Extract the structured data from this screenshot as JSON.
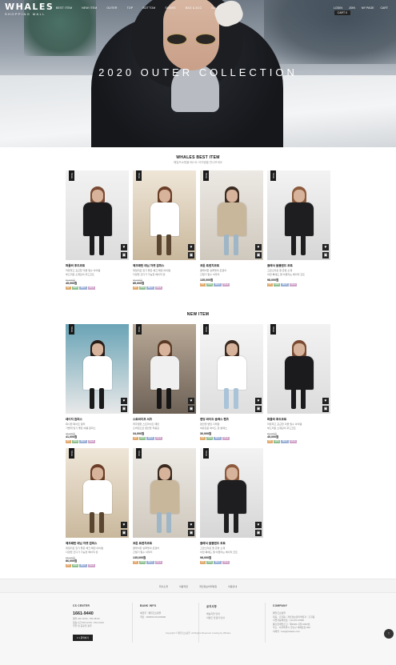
{
  "header": {
    "logo_main": "WHALES",
    "logo_sub": "SHOPPING MALL",
    "gnb": [
      "BEST ITEM",
      "NEW ITEM",
      "OUTER",
      "TOP",
      "BOTTOM",
      "SHOES",
      "BAG & ACC",
      "SALE"
    ],
    "util": [
      "LOGIN",
      "JOIN",
      "MY PAGE",
      "CART"
    ],
    "cart_badge": "CART 0"
  },
  "hero": {
    "title": "2020 OUTER COLLECTION"
  },
  "best": {
    "title": "WHALES BEST ITEM",
    "subtitle": "웨일즈쇼핑몰 베스트 아이템을 만나보세요",
    "products": [
      {
        "name": "퍼플러 후드코트",
        "desc": [
          "따뜻하고 포근한 겨울 필수 아이템",
          "부드러운 소재감의 후드코트"
        ],
        "oprice": "50,000원",
        "price": "45,000원",
        "sale": "SALE"
      },
      {
        "name": "체크패턴 데님 자켓 원피스",
        "desc": [
          "데일리로 입기 좋은 체크 패턴 아이템",
          "다양한 코디가 가능한 베이직 핏"
        ],
        "oprice": "95,000원",
        "price": "85,000원",
        "sale": "SALE"
      },
      {
        "name": "코튼 트렌치코트",
        "desc": [
          "클래식한 실루엣의 트렌치",
          "간절기 필수 아우터"
        ],
        "oprice": "",
        "price": "135,000원",
        "sale": "SALE"
      },
      {
        "name": "클래식 울블렌드 코트",
        "desc": [
          "고급스러운 울 혼방 소재",
          "어떤 룩에도 잘 어울리는 베이직 코트"
        ],
        "oprice": "",
        "price": "98,000원",
        "sale": "SALE"
      }
    ]
  },
  "newitem": {
    "title": "NEW ITEM",
    "products": [
      {
        "name": "데이지 원피스",
        "desc": [
          "화사한 화이트 컬러",
          "가볍게 입기 좋은 여름 원피스"
        ],
        "oprice": "45,000원",
        "price": "41,000원",
        "sale": "SALE"
      },
      {
        "name": "스트라이프 셔츠",
        "desc": [
          "캐주얼한 스트라이프 패턴",
          "오버핏으로 편안한 착용감"
        ],
        "oprice": "",
        "price": "34,000원",
        "sale": "SALE"
      },
      {
        "name": "밴딩 와이드 슬랙스 팬츠",
        "desc": [
          "편안한 밴딩 디테일",
          "여유로운 와이드 핏 슬랙스"
        ],
        "oprice": "",
        "price": "30,000원",
        "sale": "SALE"
      },
      {
        "name": "퍼플러 후드코트",
        "desc": [
          "따뜻하고 포근한 겨울 필수 아이템",
          "부드러운 소재감의 후드코트"
        ],
        "oprice": "50,000원",
        "price": "45,000원",
        "sale": "SALE"
      },
      {
        "name": "체크패턴 데님 자켓 원피스",
        "desc": [
          "데일리로 입기 좋은 체크 패턴 아이템",
          "다양한 코디가 가능한 베이직 핏"
        ],
        "oprice": "95,000원",
        "price": "86,000원",
        "sale": "SALE"
      },
      {
        "name": "코튼 트렌치코트",
        "desc": [
          "클래식한 실루엣의 트렌치",
          "간절기 필수 아우터"
        ],
        "oprice": "",
        "price": "135,000원",
        "sale": "SALE"
      },
      {
        "name": "클래식 울블렌드 코트",
        "desc": [
          "고급스러운 울 혼방 소재",
          "어떤 룩에도 잘 어울리는 베이직 코트"
        ],
        "oprice": "",
        "price": "98,000원",
        "sale": "SALE"
      }
    ]
  },
  "tags": [
    "HIT",
    "NEW",
    "BEST",
    "SALE"
  ],
  "tag_colors": [
    "#e0a96d",
    "#8fbf8f",
    "#9bb0d6",
    "#cfa4c8"
  ],
  "footer_links": [
    "회사소개",
    "이용약관",
    "개인정보처리방침",
    "이용안내"
  ],
  "footer": {
    "cs": {
      "title": "CS CENTER",
      "phone": "1661-9440",
      "lines": [
        "평일 AM 10:00 - PM 18:00",
        "점심시간 PM 12:00 - PM 13:00",
        "주말 및 공휴일 휴무"
      ],
      "btn": "1:1 문의하기"
    },
    "bank": {
      "title": "BANK INFO",
      "lines": [
        "예금주 : 웨일즈쇼핑몰",
        "국민 : 000000-00-000000"
      ]
    },
    "notice": {
      "title": "공지사항",
      "lines": [
        "배송지연 안내",
        "이벤트 당첨자 안내"
      ]
    },
    "company": {
      "title": "COMPANY",
      "lines": [
        "웨일즈쇼핑몰",
        "대표 : 홍길동 | 개인정보관리책임자 : 홍길동",
        "사업자등록번호 : 123-45-67890",
        "통신판매업신고 : 제2020-서울-0000호",
        "주소 : 서울특별시 강남구 테헤란로 000",
        "이메일 : help@whales.com"
      ]
    }
  },
  "copyright": "Copyright © 웨일즈쇼핑몰. All Rights Reserved. hosting by Whales",
  "top_btn": "↑"
}
